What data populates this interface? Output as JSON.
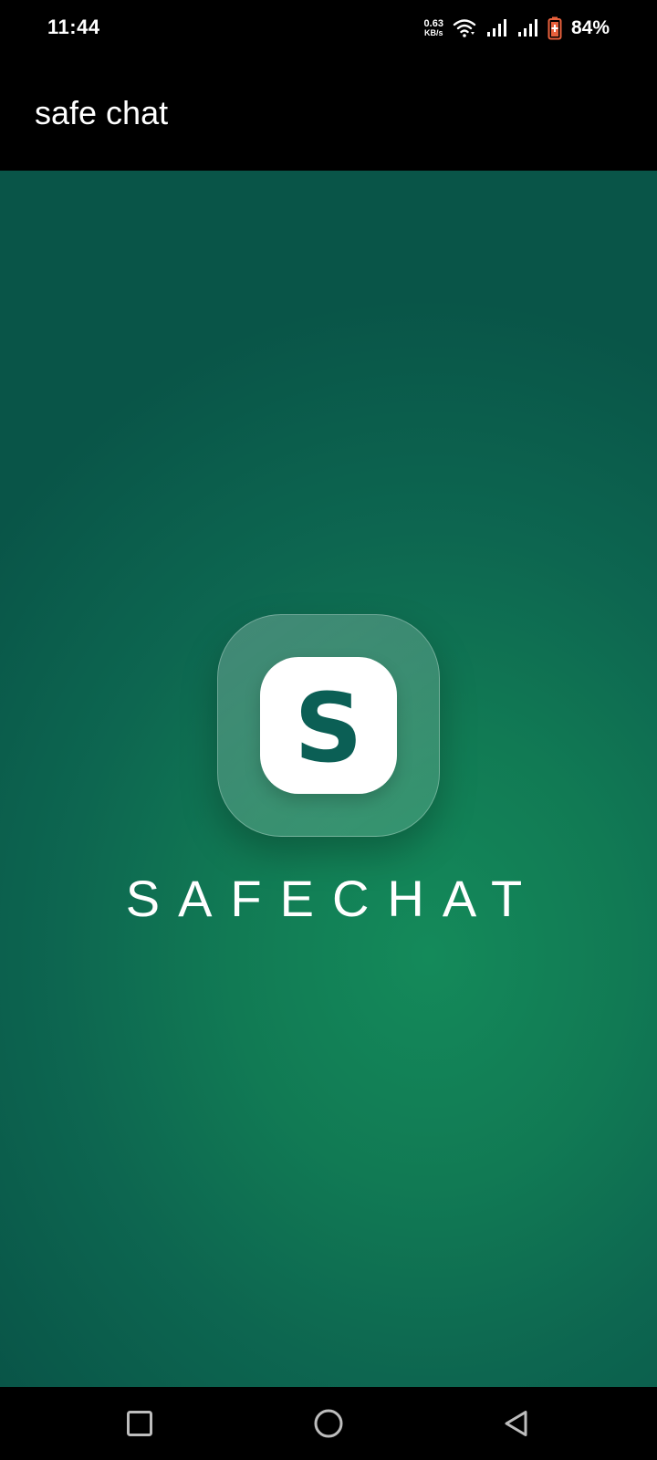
{
  "status_bar": {
    "time": "11:44",
    "net_speed_value": "0.63",
    "net_speed_unit": "KB/s",
    "battery_percent": "84%",
    "icons": [
      "wifi-icon",
      "signal-icon",
      "signal-icon",
      "battery-charging-icon"
    ]
  },
  "app_bar": {
    "title": "safe chat"
  },
  "splash": {
    "logo_letter": "S",
    "brand_name": "SAFECHAT",
    "colors": {
      "background_center": "#148a5a",
      "background_edge": "#095548",
      "logo_letter": "#0b5f55",
      "battery_accent": "#e8603c"
    }
  },
  "nav_bar": {
    "buttons": [
      "recents-square-icon",
      "home-circle-icon",
      "back-triangle-icon"
    ]
  }
}
